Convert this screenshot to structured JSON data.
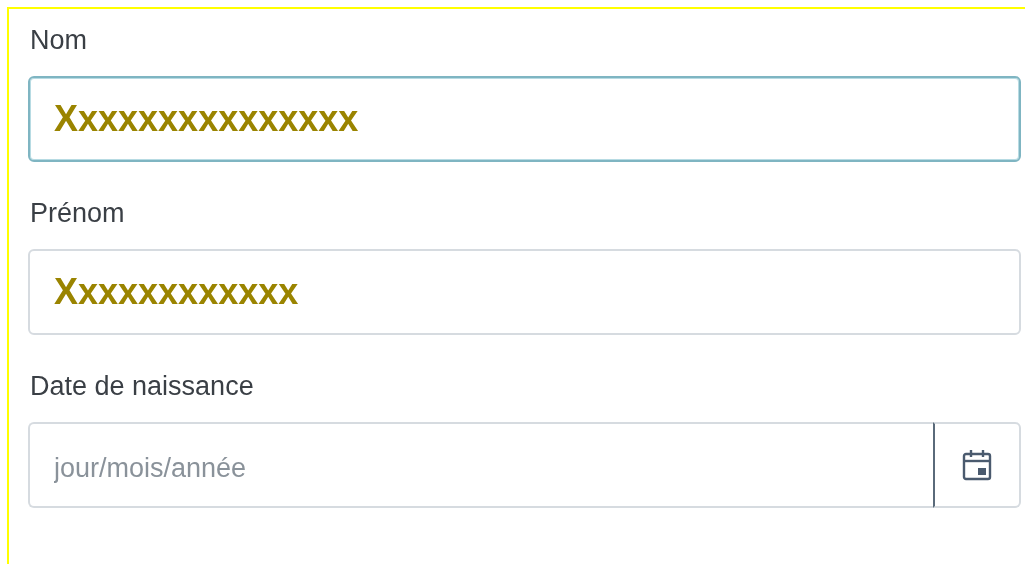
{
  "fields": [
    {
      "kind": "text",
      "label": "Nom",
      "value": "Xxxxxxxxxxxxxxx",
      "focused": true
    },
    {
      "kind": "text",
      "label": "Prénom",
      "value": "Xxxxxxxxxxxx",
      "focused": false
    },
    {
      "kind": "date",
      "label": "Date de naissance",
      "placeholder": "jour/mois/année",
      "focused": false
    }
  ]
}
